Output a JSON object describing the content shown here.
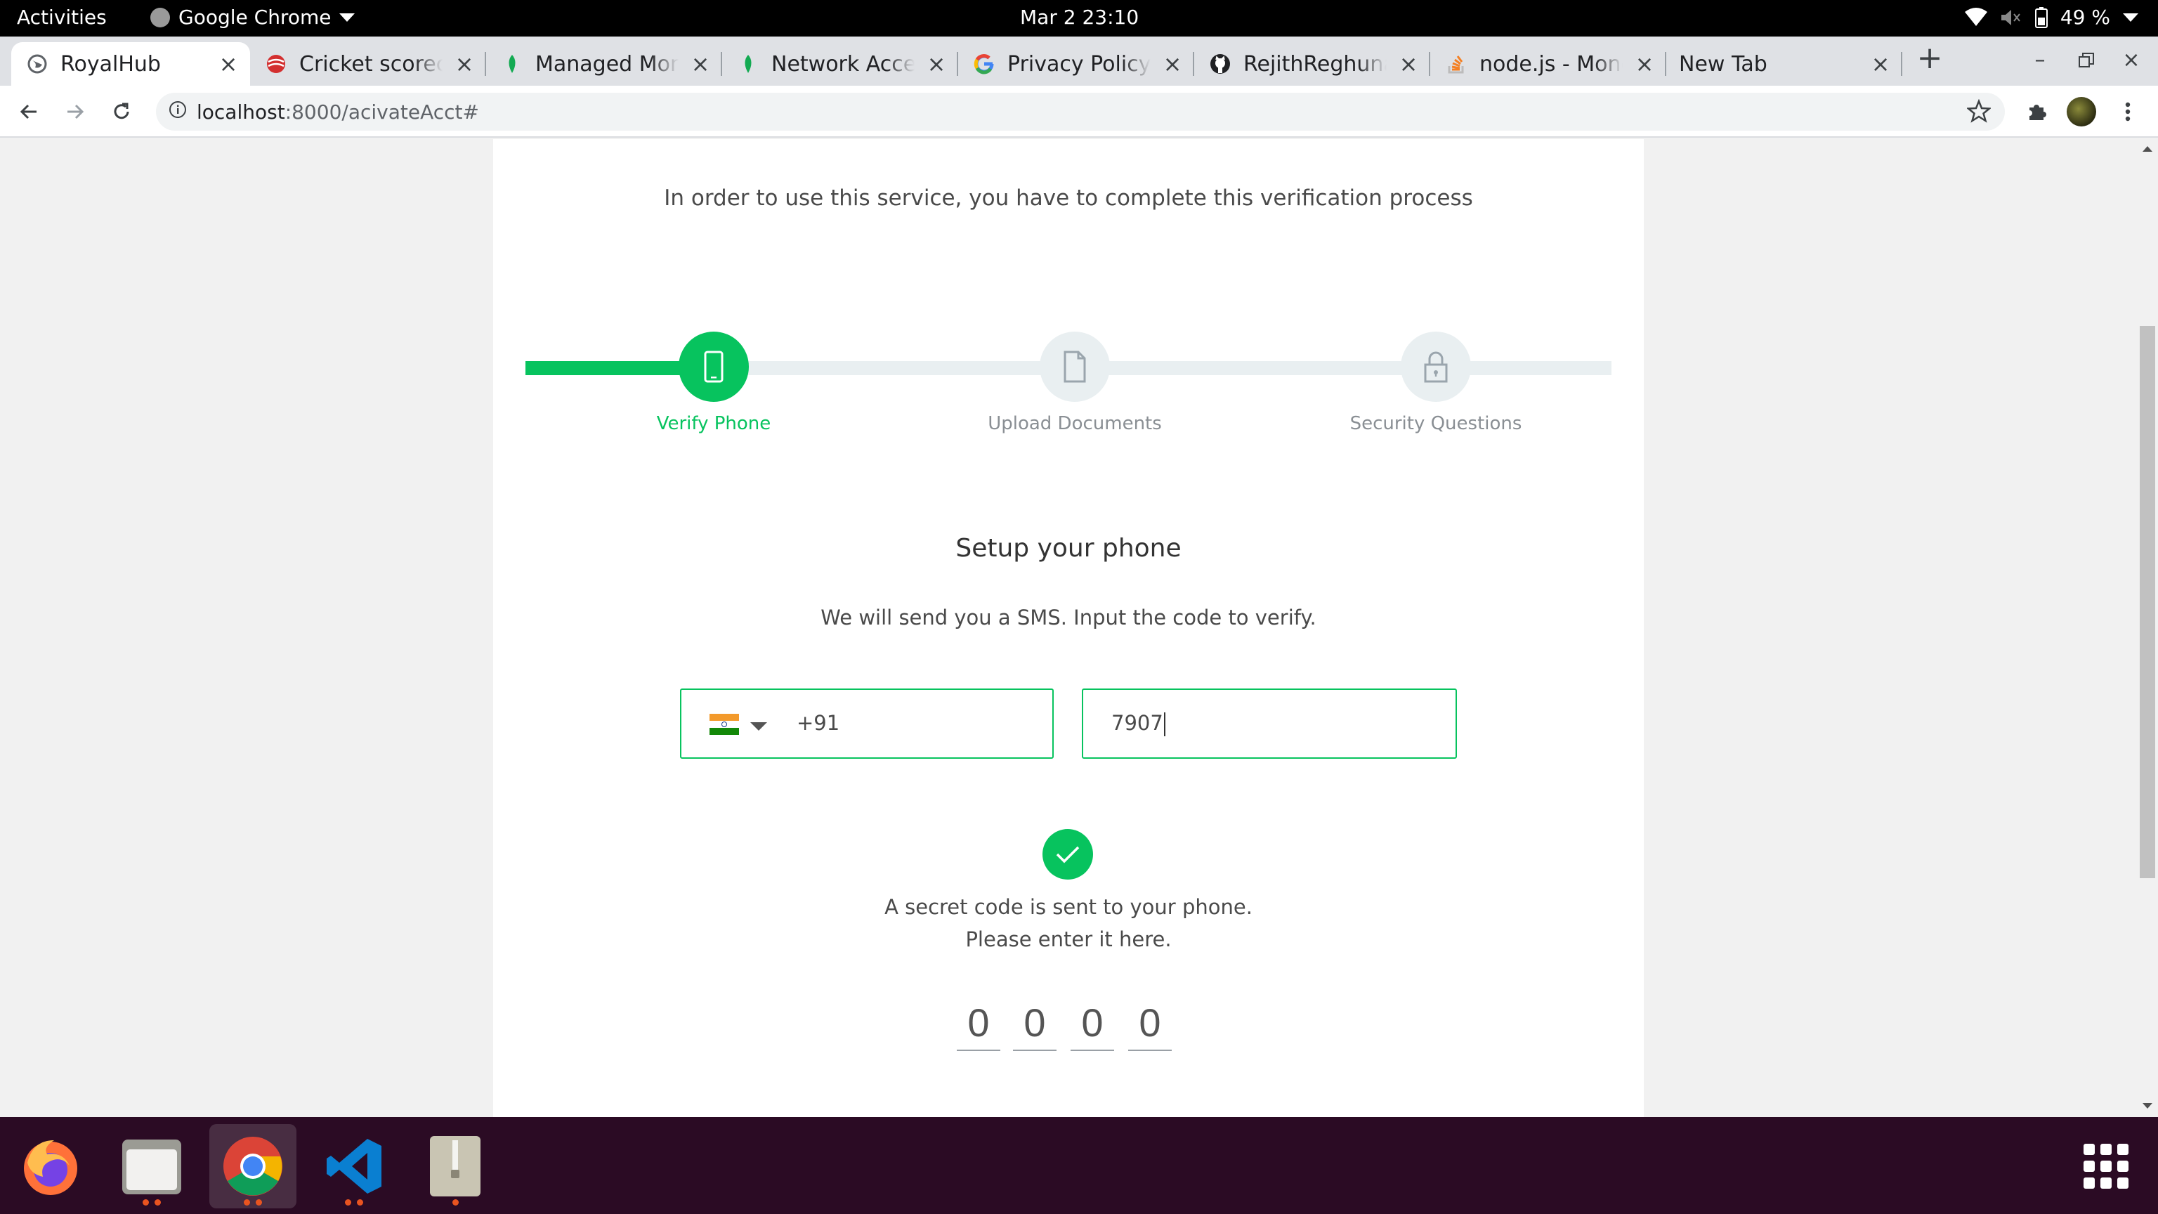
{
  "topbar": {
    "activities": "Activities",
    "app_name": "Google Chrome",
    "clock": "Mar 2  23:10",
    "battery": "49 %"
  },
  "tabs": [
    {
      "title": "RoyalHub",
      "icon": "globe-icon",
      "active": true
    },
    {
      "title": "Cricket scoreca",
      "icon": "cricket-icon"
    },
    {
      "title": "Managed Mong",
      "icon": "mongodb-leaf-icon"
    },
    {
      "title": "Network Acces",
      "icon": "mongodb-leaf-icon"
    },
    {
      "title": "Privacy Policy -",
      "icon": "google-icon"
    },
    {
      "title": "RejithReghunat",
      "icon": "github-icon"
    },
    {
      "title": "node.js - Mong",
      "icon": "stackoverflow-icon"
    },
    {
      "title": "New Tab",
      "icon": "none"
    }
  ],
  "address": {
    "host": "localhost",
    "path": ":8000/acivateAcct#"
  },
  "page": {
    "intro": "In order to use this service, you have to complete this verification process",
    "steps": [
      {
        "label": "Verify Phone",
        "icon": "phone-icon",
        "state": "active"
      },
      {
        "label": "Upload Documents",
        "icon": "document-icon",
        "state": "pending"
      },
      {
        "label": "Security Questions",
        "icon": "lock-icon",
        "state": "pending"
      }
    ],
    "setup_title": "Setup your phone",
    "setup_sub": "We will send you a SMS. Input the code to verify.",
    "country_code": "+91",
    "country_flag": "india-flag-icon",
    "phone_value": "7907",
    "sent_line1": "A secret code is sent to your phone.",
    "sent_line2": "Please enter it here.",
    "otp": [
      "0",
      "0",
      "0",
      "0"
    ]
  },
  "dock": [
    "firefox-icon",
    "files-icon",
    "chrome-icon",
    "vscode-icon",
    "archive-icon"
  ],
  "colors": {
    "accent": "#07c35e",
    "dock": "#2b0b24",
    "track": "#e9eff1"
  }
}
